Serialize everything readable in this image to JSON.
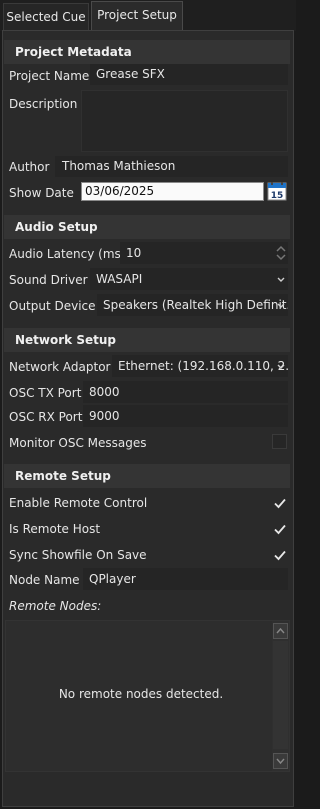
{
  "tabs": [
    {
      "label": "Selected Cue",
      "active": false
    },
    {
      "label": "Project Setup",
      "active": true
    }
  ],
  "project_metadata": {
    "heading": "Project Metadata",
    "project_name_label": "Project Name",
    "project_name_value": "Grease SFX",
    "description_label": "Description",
    "description_value": "",
    "author_label": "Author",
    "author_value": "Thomas Mathieson",
    "show_date_label": "Show Date",
    "show_date_value": "03/06/2025",
    "calendar_day": "15"
  },
  "audio_setup": {
    "heading": "Audio Setup",
    "latency_label": "Audio Latency (ms)",
    "latency_value": "10",
    "sound_driver_label": "Sound Driver",
    "sound_driver_value": "WASAPI",
    "output_device_label": "Output Device",
    "output_device_value": "Speakers (Realtek High Definit..."
  },
  "network_setup": {
    "heading": "Network Setup",
    "adaptor_label": "Network Adaptor",
    "adaptor_value": "Ethernet: (192.168.0.110, 2...",
    "osc_tx_label": "OSC TX Port",
    "osc_tx_value": "8000",
    "osc_rx_label": "OSC RX Port",
    "osc_rx_value": "9000",
    "monitor_osc_label": "Monitor OSC Messages",
    "monitor_osc_checked": false
  },
  "remote_setup": {
    "heading": "Remote Setup",
    "enable_remote_label": "Enable Remote Control",
    "enable_remote_checked": true,
    "is_remote_host_label": "Is Remote Host",
    "is_remote_host_checked": true,
    "sync_showfile_label": "Sync Showfile On Save",
    "sync_showfile_checked": true,
    "node_name_label": "Node Name",
    "node_name_value": "QPlayer",
    "remote_nodes_label": "Remote Nodes:",
    "remote_nodes_empty": "No remote nodes detected."
  },
  "colors": {
    "background": "#2a2a2a",
    "section_header": "#343434",
    "text": "#e6e6e6",
    "date_field": "#fafafa",
    "calendar_accent": "#1e73c8"
  },
  "icons": {
    "calendar": "calendar-icon",
    "dropdown": "chevron-down-icon",
    "spinner": "spinner-arrows-icon",
    "check": "checkmark-icon"
  }
}
